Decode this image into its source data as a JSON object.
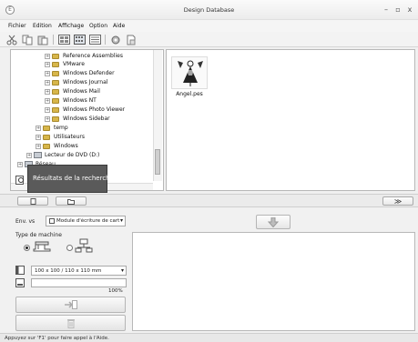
{
  "window": {
    "title": "Design Database",
    "app_icon": "E",
    "buttons": [
      "–",
      "▫",
      "x"
    ]
  },
  "menu": {
    "items": [
      "Fichier",
      "Edition",
      "Affichage",
      "Option",
      "Aide"
    ]
  },
  "toolbar": {
    "icons": [
      "cut-icon",
      "copy-icon",
      "paste-icon",
      "large-thumbnails-icon",
      "small-thumbnails-icon",
      "details-view-icon",
      "properties-icon",
      "document-icon"
    ]
  },
  "tree": {
    "items": [
      {
        "label": "Reference Assemblies",
        "type": "folder"
      },
      {
        "label": "VMware",
        "type": "folder"
      },
      {
        "label": "Windows Defender",
        "type": "folder"
      },
      {
        "label": "Windows Journal",
        "type": "folder"
      },
      {
        "label": "Windows Mail",
        "type": "folder"
      },
      {
        "label": "Windows NT",
        "type": "folder"
      },
      {
        "label": "Windows Photo Viewer",
        "type": "folder"
      },
      {
        "label": "Windows Sidebar",
        "type": "folder"
      },
      {
        "label": "temp",
        "type": "folder"
      },
      {
        "label": "Utilisateurs",
        "type": "folder"
      },
      {
        "label": "Windows",
        "type": "folder"
      },
      {
        "label": "Lecteur de DVD (D:)",
        "type": "drive"
      },
      {
        "label": "Réseau",
        "type": "network"
      }
    ],
    "tooltip": "Résultats de la recherche"
  },
  "files": {
    "items": [
      {
        "name": "Angel.pes"
      }
    ]
  },
  "divider": {
    "collapse_label": "≫"
  },
  "lower": {
    "env_label": "Env. vs",
    "module_select": "Module d'écriture de cart",
    "machine_type_label": "Type de machine",
    "machine_options": [
      "embroidery-machine-icon",
      "network-machine-icon"
    ],
    "machine_selected": 0,
    "hoop_size": "100 x 100 / 110 x 110 mm",
    "progress_value": "100%",
    "progress_fraction": 1.0
  },
  "status": {
    "text": "Appuyez sur 'F1' pour faire appel à l'Aide."
  },
  "colors": {
    "tooltip_bg": "#5a5a5a",
    "folder": "#d7b64a",
    "panel_border": "#b8b8b8"
  }
}
